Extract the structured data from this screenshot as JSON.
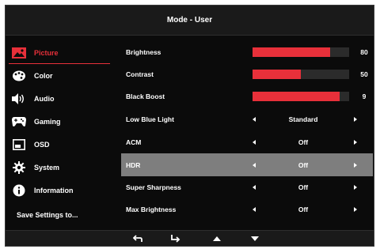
{
  "title": "Mode - User",
  "sidebar": {
    "items": [
      {
        "label": "Picture",
        "icon": "picture-icon",
        "active": true
      },
      {
        "label": "Color",
        "icon": "palette-icon",
        "active": false
      },
      {
        "label": "Audio",
        "icon": "speaker-icon",
        "active": false
      },
      {
        "label": "Gaming",
        "icon": "gamepad-icon",
        "active": false
      },
      {
        "label": "OSD",
        "icon": "osd-window-icon",
        "active": false
      },
      {
        "label": "System",
        "icon": "gear-icon",
        "active": false
      },
      {
        "label": "Information",
        "icon": "info-icon",
        "active": false
      }
    ],
    "save_label": "Save Settings to..."
  },
  "settings": {
    "brightness": {
      "label": "Brightness",
      "value": "80",
      "level": 0.8
    },
    "contrast": {
      "label": "Contrast",
      "value": "50",
      "level": 0.5
    },
    "black_boost": {
      "label": "Black Boost",
      "value": "9",
      "level": 0.9
    },
    "low_blue_light": {
      "label": "Low Blue Light",
      "value": "Standard"
    },
    "acm": {
      "label": "ACM",
      "value": "Off"
    },
    "hdr": {
      "label": "HDR",
      "value": "Off",
      "selected": true
    },
    "super_sharpness": {
      "label": "Super Sharpness",
      "value": "Off"
    },
    "max_brightness": {
      "label": "Max Brightness",
      "value": "Off"
    }
  },
  "navigation": {
    "buttons": [
      "return-icon",
      "enter-icon",
      "up-arrow-icon",
      "down-arrow-icon"
    ]
  },
  "colors": {
    "accent": "#e8303a",
    "background": "#0b0b0b",
    "selected_row": "#7e7e7e"
  }
}
